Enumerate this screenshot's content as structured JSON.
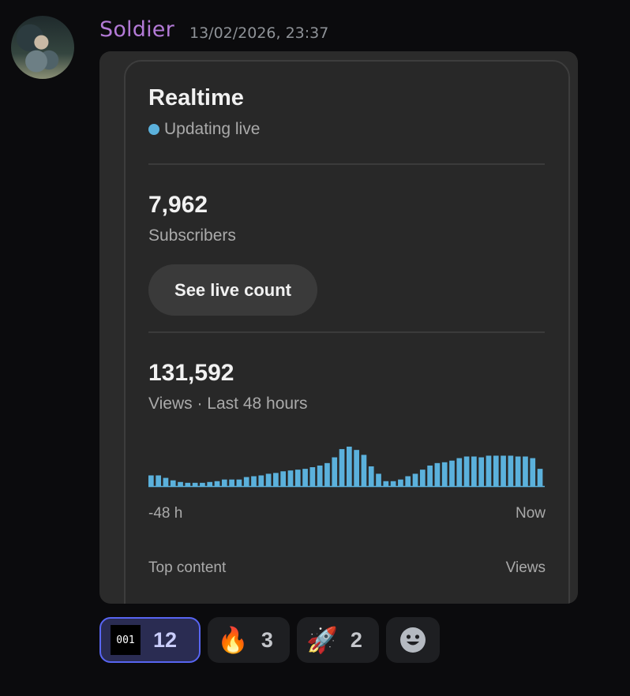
{
  "message": {
    "author": "Soldier",
    "timestamp": "13/02/2026, 23:37",
    "author_color": "#b37ad6"
  },
  "card": {
    "title": "Realtime",
    "live_status": "Updating live",
    "subscribers_value": "7,962",
    "subscribers_label": "Subscribers",
    "live_count_button": "See live count",
    "views_value": "131,592",
    "views_label": "Views · Last 48 hours",
    "axis_start": "-48 h",
    "axis_end": "Now",
    "top_content_label": "Top content",
    "views_column_label": "Views",
    "accent_color": "#5bb1dc"
  },
  "chart_data": {
    "type": "bar",
    "xlabel": "",
    "ylabel": "",
    "x_start_label": "-48 h",
    "x_end_label": "Now",
    "values": [
      13,
      13,
      10,
      7,
      5,
      4,
      4,
      4,
      5,
      6,
      8,
      8,
      8,
      11,
      12,
      13,
      15,
      16,
      18,
      19,
      20,
      21,
      23,
      25,
      28,
      35,
      45,
      48,
      44,
      38,
      24,
      15,
      6,
      6,
      8,
      12,
      15,
      20,
      25,
      28,
      29,
      31,
      34,
      36,
      36,
      35,
      37,
      37,
      37,
      37,
      36,
      36,
      34,
      21
    ],
    "color": "#5bb1dc"
  },
  "reactions": [
    {
      "emoji_text": "001",
      "count": "12",
      "active": true
    },
    {
      "emoji": "🔥",
      "count": "3"
    },
    {
      "emoji": "🚀",
      "count": "2"
    }
  ]
}
